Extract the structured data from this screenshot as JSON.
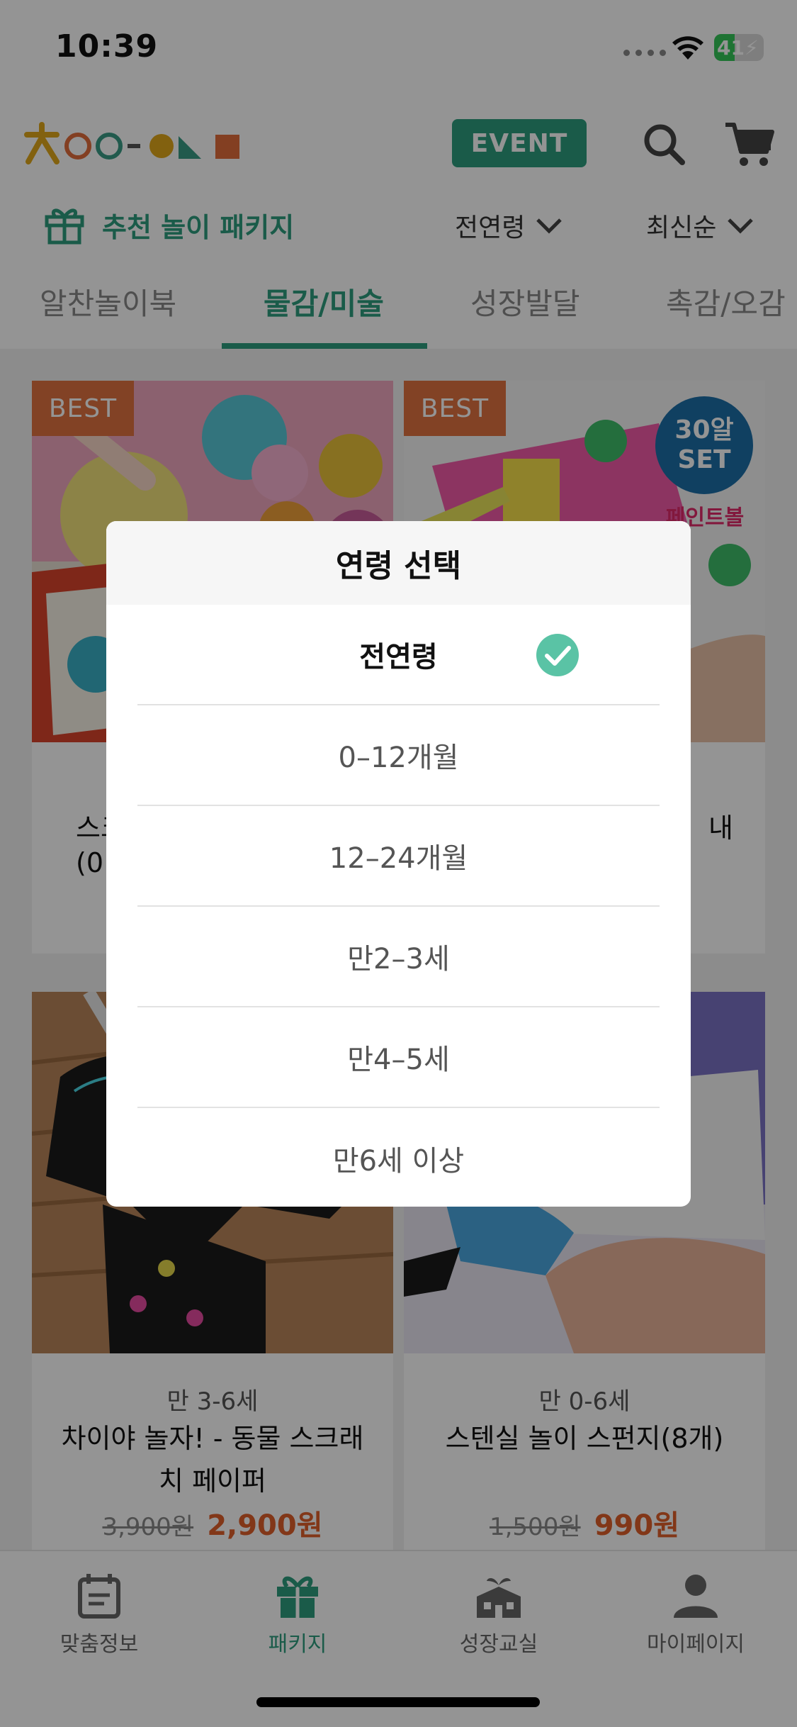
{
  "status_bar": {
    "time": "10:39",
    "battery": "41",
    "battery_level": 0.41
  },
  "header": {
    "event_label": "EVENT",
    "package_title": "추천 놀이 패키지",
    "age_filter": "전연령",
    "sort_filter": "최신순"
  },
  "category_tabs": [
    {
      "label": "알찬놀이북"
    },
    {
      "label": "물감/미술"
    },
    {
      "label": "성장발달"
    },
    {
      "label": "촉감/오감"
    }
  ],
  "products": [
    {
      "badge": "BEST",
      "partial_name_line1": "스크",
      "partial_name_line2": "(0"
    },
    {
      "badge": "BEST",
      "sticker_line1": "30알",
      "sticker_line2": "SET",
      "sticker_caption": "페인트볼",
      "partial_name": "내"
    },
    {
      "age": "만 3-6세",
      "name": "차이야 놀자! - 동물 스크래치 페이퍼",
      "price_original": "3,900원",
      "price_sale": "2,900원"
    },
    {
      "age": "만 0-6세",
      "name": "스텐실 놀이 스펀지(8개)",
      "price_original": "1,500원",
      "price_sale": "990원"
    }
  ],
  "bottom_nav": [
    {
      "label": "맞춤정보",
      "icon": "calendar-icon"
    },
    {
      "label": "패키지",
      "icon": "gift-icon"
    },
    {
      "label": "성장교실",
      "icon": "school-icon"
    },
    {
      "label": "마이페이지",
      "icon": "person-icon"
    }
  ],
  "age_modal": {
    "title": "연령 선택",
    "options": [
      {
        "label": "전연령",
        "selected": true
      },
      {
        "label": "0–12개월"
      },
      {
        "label": "12–24개월"
      },
      {
        "label": "만2–3세"
      },
      {
        "label": "만4–5세"
      },
      {
        "label": "만6세 이상"
      }
    ]
  },
  "colors": {
    "brand_green": "#2e9e7f",
    "best_orange": "#e07240",
    "sale_red": "#e0602a"
  }
}
